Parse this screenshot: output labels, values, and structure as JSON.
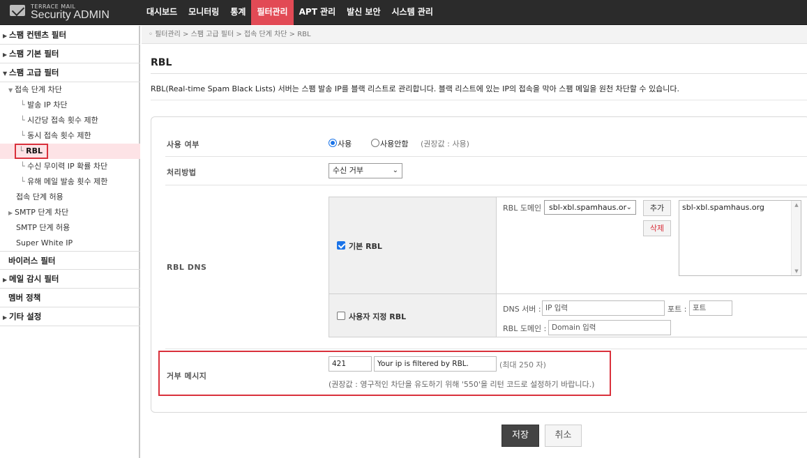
{
  "app": {
    "logo_small": "TERRACE MAIL",
    "logo_big": "Security ADMIN"
  },
  "nav": [
    {
      "label": "대시보드"
    },
    {
      "label": "모니터링"
    },
    {
      "label": "통계"
    },
    {
      "label": "필터관리"
    },
    {
      "label": "APT 관리"
    },
    {
      "label": "발신 보안"
    },
    {
      "label": "시스템 관리"
    }
  ],
  "sidebar": {
    "spam_content": "스팸 컨텐츠 필터",
    "spam_basic": "스팸 기본 필터",
    "spam_advanced": "스팸 고급 필터",
    "conn_block": "접속 단계 차단",
    "send_ip_block": "발송 IP 차단",
    "hourly_limit": "시간당 접속 횟수 제한",
    "concurrent_limit": "동시 접속 횟수 제한",
    "rbl": "RBL",
    "random_ip": "수신 무이력 IP 확률 차단",
    "harmful_limit": "유해 메일 발송 횟수 제한",
    "conn_allow": "접속 단계 허용",
    "smtp_block": "SMTP 단계 차단",
    "smtp_allow": "SMTP 단계 허용",
    "super_white": "Super White IP",
    "virus": "바이러스 필터",
    "mail_audit": "메일 감시 필터",
    "member_policy": "멤버 정책",
    "etc": "기타 설정"
  },
  "breadcrumb": "◦ 필터관리 > 스팸 고급 필터 > 접속 단계 차단 > RBL",
  "page": {
    "title": "RBL",
    "description": "RBL(Real-time Spam Black Lists) 서버는 스팸 발송 IP를 블랙 리스트로 관리합니다. 블랙 리스트에 있는 IP의 접속을 막아 스팸 메일을 원천 차단할 수 있습니다."
  },
  "form": {
    "use_label": "사용 여부",
    "use_on": "사용",
    "use_off": "사용안함",
    "use_hint": "(권장값 : 사용)",
    "use_value": "on",
    "method_label": "처리방법",
    "method_value": "수신 거부",
    "dns_label": "RBL DNS",
    "default_rbl": "기본 RBL",
    "default_rbl_checked": true,
    "rbl_domain_label": "RBL 도메인",
    "rbl_domain_select": "sbl-xbl.spamhaus.or",
    "add_button": "추가",
    "delete_button": "삭제",
    "rbl_list": "sbl-xbl.spamhaus.org",
    "custom_rbl": "사용자 지정 RBL",
    "custom_rbl_checked": false,
    "dns_server_label": "DNS 서버 :",
    "dns_server_placeholder": "IP 입력",
    "port_label": "포트 :",
    "port_placeholder": "포트",
    "custom_domain_label": "RBL 도메인 :",
    "custom_domain_placeholder": "Domain 입력",
    "reject_label": "거부 메시지",
    "reject_code": "421",
    "reject_message": "Your ip is filtered by RBL.",
    "reject_max": "(최대 250 자)",
    "reject_hint": "(권장값 : 영구적인 차단을 유도하기 위해 '550'을 리턴 코드로 설정하기 바랍니다.)"
  },
  "actions": {
    "save": "저장",
    "cancel": "취소"
  },
  "colors": {
    "accent": "#e24a55",
    "highlight_frame": "#d9303b",
    "topbar": "#2b2b2b",
    "checkbox": "#1a73e8"
  }
}
